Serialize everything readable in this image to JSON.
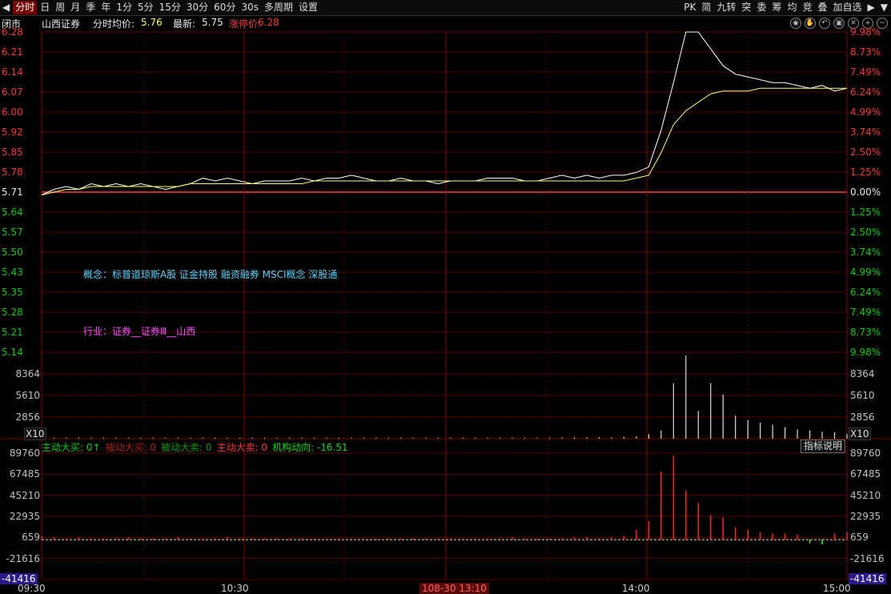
{
  "toolbar": {
    "left_items": [
      "分时",
      "日",
      "周",
      "月",
      "季",
      "年",
      "1分",
      "5分",
      "15分",
      "30分",
      "60分",
      "30s",
      "多周期",
      "设置"
    ],
    "active_index": 0,
    "right_items": [
      "PK",
      "简",
      "九转",
      "突",
      "委",
      "筹",
      "均",
      "竞",
      "叠",
      "加自选"
    ]
  },
  "header": {
    "status": "闭市",
    "stock_name": "山西证券",
    "chart_type": "分时",
    "avg_label": "均价:",
    "avg_value": "5.76",
    "last_label": "最新:",
    "last_value": "5.75",
    "limit_label": "涨停价:",
    "limit_value": "6.28"
  },
  "price_axis": {
    "left": [
      "6.28",
      "6.21",
      "6.14",
      "6.07",
      "6.00",
      "5.92",
      "5.85",
      "5.78",
      "5.71",
      "5.64",
      "5.57",
      "5.50",
      "5.43",
      "5.35",
      "5.28",
      "5.21",
      "5.14"
    ],
    "right": [
      "9.98%",
      "8.73%",
      "7.49%",
      "6.24%",
      "4.99%",
      "3.74%",
      "2.50%",
      "1.25%",
      "0.00%",
      "1.25%",
      "2.50%",
      "3.74%",
      "4.99%",
      "6.24%",
      "7.49%",
      "8.73%",
      "9.98%"
    ]
  },
  "volume_axis": [
    "8364",
    "5610",
    "2856"
  ],
  "volume_multiplier": "X10",
  "concept_text": "概念：标普道琼斯A股 证金持股 融资融券 MSCI概念 深股通",
  "industry_text": "行业：证券__证券Ⅲ__山西",
  "sub_panel": {
    "items": [
      {
        "text": "主动大买: 0↑",
        "color": "#00d000"
      },
      {
        "text": "被动大买: 0",
        "color": "#b02020"
      },
      {
        "text": "被动大卖: 0",
        "color": "#00a000"
      },
      {
        "text": "主动大卖: 0",
        "color": "#ff3232"
      },
      {
        "text": "机构动向: -16.51",
        "color": "#00e000"
      }
    ],
    "indicator_button": "指标说明",
    "axis": [
      "89760",
      "67485",
      "45210",
      "22935",
      "659",
      "-21616",
      "-41416"
    ]
  },
  "time_axis": [
    "09:30",
    "10:30",
    "108-30 13:10",
    "14:00",
    "15:00"
  ],
  "chart_data": {
    "type": "line",
    "price_range": [
      5.14,
      6.28
    ],
    "prev_close": 5.71,
    "series": [
      {
        "values": [
          5.7,
          5.72,
          5.73,
          5.72,
          5.74,
          5.73,
          5.74,
          5.73,
          5.74,
          5.73,
          5.72,
          5.73,
          5.74,
          5.76,
          5.75,
          5.76,
          5.75,
          5.74,
          5.75,
          5.75,
          5.75,
          5.76,
          5.75,
          5.76,
          5.76,
          5.77,
          5.76,
          5.75,
          5.75,
          5.76,
          5.75,
          5.75,
          5.74,
          5.75,
          5.75,
          5.75,
          5.76,
          5.76,
          5.76,
          5.75,
          5.75,
          5.76,
          5.77,
          5.76,
          5.77,
          5.76,
          5.77,
          5.77,
          5.78,
          5.8,
          5.93,
          6.1,
          6.28,
          6.28,
          6.22,
          6.16,
          6.13,
          6.12,
          6.11,
          6.1,
          6.1,
          6.09,
          6.08,
          6.09,
          6.07,
          6.08
        ]
      },
      {
        "values": [
          5.7,
          5.71,
          5.72,
          5.72,
          5.73,
          5.73,
          5.73,
          5.73,
          5.73,
          5.73,
          5.73,
          5.73,
          5.74,
          5.74,
          5.74,
          5.74,
          5.74,
          5.74,
          5.74,
          5.74,
          5.74,
          5.74,
          5.75,
          5.75,
          5.75,
          5.75,
          5.75,
          5.75,
          5.75,
          5.75,
          5.75,
          5.75,
          5.75,
          5.75,
          5.75,
          5.75,
          5.75,
          5.75,
          5.75,
          5.75,
          5.75,
          5.75,
          5.75,
          5.75,
          5.75,
          5.75,
          5.75,
          5.75,
          5.76,
          5.77,
          5.85,
          5.95,
          6.0,
          6.03,
          6.06,
          6.07,
          6.07,
          6.07,
          6.08,
          6.08,
          6.08,
          6.08,
          6.08,
          6.08,
          6.08,
          6.08
        ]
      }
    ],
    "volume": [
      3,
      2,
      2,
      2,
      2,
      2,
      2,
      2,
      2,
      2,
      2,
      2,
      2,
      2,
      2,
      2,
      2,
      2,
      2,
      2,
      2,
      2,
      2,
      2,
      2,
      2,
      2,
      2,
      2,
      2,
      2,
      2,
      2,
      2,
      2,
      2,
      2,
      2,
      2,
      2,
      2,
      2,
      3,
      3,
      3,
      3,
      3,
      4,
      5,
      10,
      18,
      120,
      180,
      60,
      120,
      95,
      50,
      40,
      35,
      30,
      25,
      20,
      18,
      15,
      14,
      10
    ],
    "flow": [
      3,
      2,
      1,
      2,
      1,
      1,
      1,
      2,
      1,
      1,
      1,
      2,
      1,
      1,
      1,
      2,
      1,
      1,
      1,
      1,
      1,
      1,
      1,
      1,
      1,
      1,
      1,
      1,
      1,
      1,
      1,
      1,
      1,
      1,
      1,
      1,
      1,
      1,
      2,
      1,
      1,
      1,
      1,
      2,
      2,
      1,
      2,
      3,
      8,
      15,
      55,
      68,
      40,
      30,
      20,
      18,
      10,
      8,
      6,
      5,
      5,
      4,
      -3,
      -4,
      5,
      6
    ],
    "flow_range": [
      -41416,
      89760
    ]
  }
}
